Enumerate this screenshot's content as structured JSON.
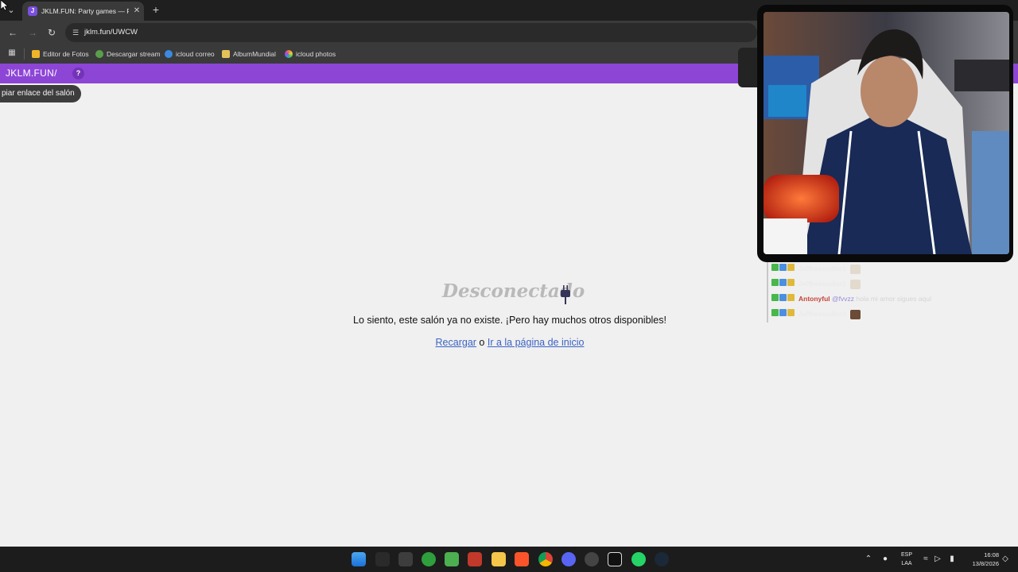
{
  "browser": {
    "tab": {
      "title": "JKLM.FUN: Party games — PC & mobile",
      "favicon": "jklm-logo-icon"
    },
    "url": "jklm.fun/UWCW",
    "bookmarks": [
      {
        "label": "Editor de Fotos",
        "icon": "photo-editor-icon",
        "color": "#f0b429"
      },
      {
        "label": "Descargar stream",
        "icon": "download-icon",
        "color": "#5a9e4b"
      },
      {
        "label": "icloud correo",
        "icon": "cloud-icon",
        "color": "#3a8be0"
      },
      {
        "label": "AlbumMundial",
        "icon": "album-icon",
        "color": "#e3c15a"
      },
      {
        "label": "icloud photos",
        "icon": "photos-icon",
        "color": "#e57e3f"
      }
    ]
  },
  "page": {
    "brand": "JKLM.FUN/",
    "help_label": "?",
    "copy_link_label": "piar enlace del salón",
    "disconnected_title": "Desconectado",
    "message": "Lo siento, este salón ya no existe. ¡Pero hay muchos otros disponibles!",
    "reload_link": "Recargar",
    "or_text": " o ",
    "home_link": "Ir a la página de inicio",
    "accent_color": "#8d45d6"
  },
  "stream": {
    "chat": [
      {
        "user": "Jeffhesvadlor1",
        "mention": "",
        "text": "",
        "user_color": "#d8d8d8",
        "emote": "hand-emote"
      },
      {
        "user": "Jeffhesvadlor1",
        "mention": "",
        "text": "",
        "user_color": "#d8d8d8",
        "emote": "hand-emote"
      },
      {
        "user": "Antonyful",
        "mention": "@fvvzz",
        "text": " hola mi amor sigues aquí",
        "user_color": "#c5463a",
        "emote": ""
      },
      {
        "user": "Jeffhesvadlor1",
        "mention": "",
        "text": "",
        "user_color": "#d8d8d8",
        "emote": "face-emote"
      }
    ]
  },
  "taskbar": {
    "lang_top": "ESP",
    "lang_bottom": "LAA",
    "time": "16:08",
    "date": "13/8/2026",
    "apps": [
      "windows-start-icon",
      "widgets-icon",
      "store-icon",
      "xbox-icon",
      "minecraft-icon",
      "among-us-icon",
      "file-explorer-icon",
      "brave-icon",
      "chrome-icon",
      "discord-icon",
      "obs-icon",
      "capcut-icon",
      "whatsapp-icon",
      "steam-icon"
    ]
  }
}
